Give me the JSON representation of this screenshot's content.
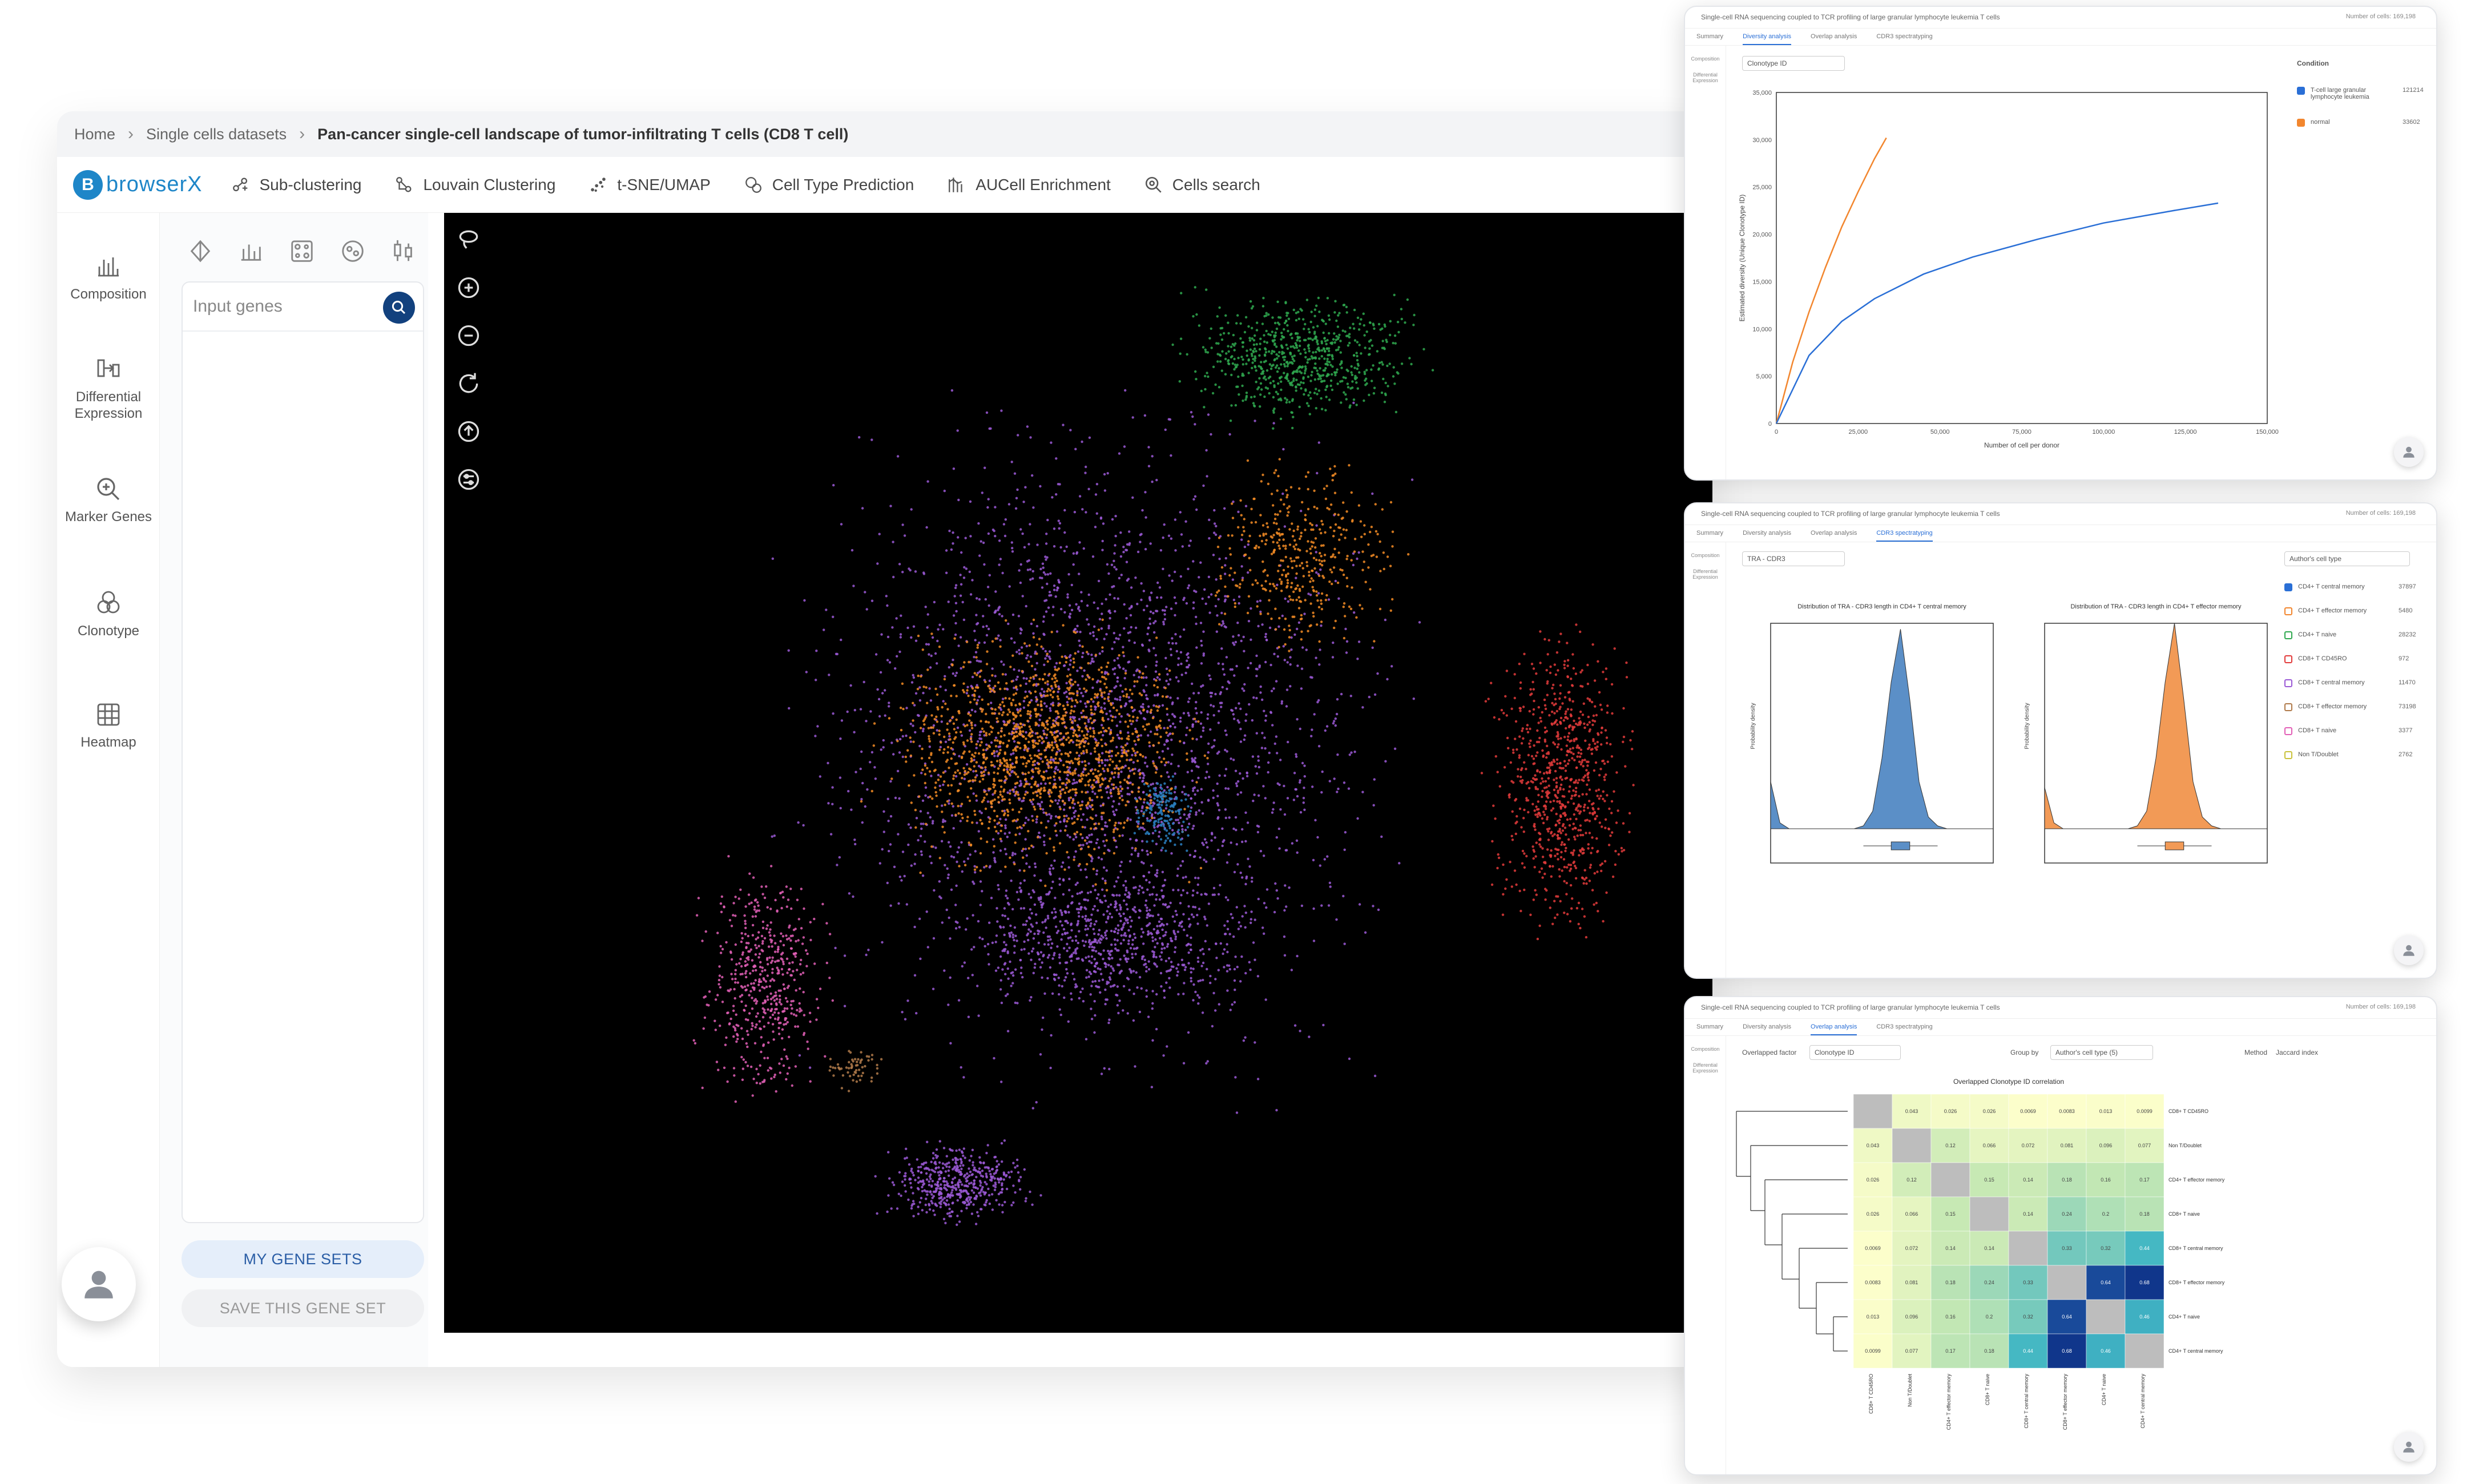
{
  "breadcrumb": {
    "home": "Home",
    "datasets": "Single cells datasets",
    "current": "Pan-cancer single-cell landscape of tumor-infiltrating T cells (CD8 T cell)"
  },
  "logo": {
    "mark": "B",
    "word": "browserX"
  },
  "toolbar": [
    {
      "label": "Sub-clustering",
      "icon": "sub-clustering-icon"
    },
    {
      "label": "Louvain Clustering",
      "icon": "louvain-icon"
    },
    {
      "label": "t-SNE/UMAP",
      "icon": "tsne-icon"
    },
    {
      "label": "Cell Type Prediction",
      "icon": "cell-type-icon"
    },
    {
      "label": "AUCell Enrichment",
      "icon": "aucell-icon"
    },
    {
      "label": "Cells search",
      "icon": "cells-search-icon"
    }
  ],
  "leftnav": [
    {
      "label": "Composition",
      "icon": "composition-icon"
    },
    {
      "label": "Differential Expression",
      "icon": "differential-expression-icon"
    },
    {
      "label": "Marker Genes",
      "icon": "marker-genes-icon"
    },
    {
      "label": "Clonotype",
      "icon": "clonotype-icon"
    },
    {
      "label": "Heatmap",
      "icon": "heatmap-icon"
    }
  ],
  "genes": {
    "placeholder": "Input genes",
    "my_sets": "MY GENE SETS",
    "save_set": "SAVE THIS GENE SET"
  },
  "umap": {
    "background": "#000000",
    "clusters": [
      "#9b59d6",
      "#f28b25",
      "#2fa84f",
      "#e23b3b",
      "#e25fb6",
      "#2a7fc0",
      "#b07a4a"
    ]
  },
  "windows": {
    "diversity": {
      "title": "Single-cell RNA sequencing coupled to TCR profiling of large granular lymphocyte leukemia T cells",
      "meta": "Number of cells: 169,198",
      "tabs": [
        "Summary",
        "Diversity analysis",
        "Overlap analysis",
        "CDR3 spectratyping"
      ],
      "active_tab": 1,
      "side": [
        "Composition",
        "Differential Expression"
      ],
      "dropdown": "Clonotype ID",
      "legend_title": "Condition",
      "legend": [
        {
          "label": "T-cell large granular lymphocyte leukemia",
          "value": "121214",
          "color": "#2a6fd6"
        },
        {
          "label": "normal",
          "value": "33602",
          "color": "#f2862e"
        }
      ]
    },
    "cdr3": {
      "title": "Single-cell RNA sequencing coupled to TCR profiling of large granular lymphocyte leukemia T cells",
      "meta": "Number of cells: 169,198",
      "tabs": [
        "Summary",
        "Diversity analysis",
        "Overlap analysis",
        "CDR3 spectratyping"
      ],
      "active_tab": 3,
      "side": [
        "Composition",
        "Differential Expression"
      ],
      "dropdown": "TRA - CDR3",
      "legend_title": "Author's cell type",
      "legend": [
        {
          "label": "CD4+ T central memory",
          "value": "37897",
          "color": "#2a6fd6"
        },
        {
          "label": "CD4+ T effector memory",
          "value": "5480",
          "color": "#f2862e"
        },
        {
          "label": "CD4+ T naive",
          "value": "28232",
          "color": "#2fa84f"
        },
        {
          "label": "CD8+ T CD45RO",
          "value": "972",
          "color": "#e23b3b"
        },
        {
          "label": "CD8+ T central memory",
          "value": "11470",
          "color": "#9b59d6"
        },
        {
          "label": "CD8+ T effector memory",
          "value": "73198",
          "color": "#b07a4a"
        },
        {
          "label": "CD8+ T naive",
          "value": "3377",
          "color": "#e25fb6"
        },
        {
          "label": "Non T/Doublet",
          "value": "2762",
          "color": "#c9c23b"
        }
      ]
    },
    "overlap": {
      "title": "Single-cell RNA sequencing coupled to TCR profiling of large granular lymphocyte leukemia T cells",
      "meta": "Number of cells: 169,198",
      "tabs": [
        "Summary",
        "Diversity analysis",
        "Overlap analysis",
        "CDR3 spectratyping"
      ],
      "active_tab": 2,
      "side": [
        "Composition",
        "Differential Expression"
      ],
      "controls": {
        "factor_label": "Overlapped factor",
        "factor_value": "Clonotype ID",
        "group_label": "Group by",
        "group_value": "Author's cell type (5)",
        "method_label": "Method",
        "method_value": "Jaccard index"
      }
    }
  },
  "chart_data": [
    {
      "type": "line",
      "ylabel": "Estimated diversity (Unique Clonotype ID)",
      "xlabel": "Number of cell per donor",
      "xlim": [
        0,
        150000
      ],
      "ylim": [
        0,
        35000
      ],
      "x_ticks": [
        "0",
        "25,000",
        "50,000",
        "75,000",
        "100,000",
        "125,000",
        "150,000"
      ],
      "y_ticks": [
        "0",
        "5,000",
        "10,000",
        "15,000",
        "20,000",
        "25,000",
        "30,000",
        "35,000"
      ],
      "series": [
        {
          "color": "#f2862e",
          "x": [
            0,
            5000,
            10000,
            15000,
            20000,
            25000,
            30000,
            33602
          ],
          "y": [
            0,
            6500,
            11800,
            16500,
            20800,
            24500,
            28000,
            30200
          ]
        },
        {
          "color": "#2a6fd6",
          "x": [
            0,
            10000,
            20000,
            30000,
            45000,
            60000,
            80000,
            100000,
            121214,
            135000
          ],
          "y": [
            0,
            7200,
            10800,
            13200,
            15800,
            17600,
            19500,
            21200,
            22500,
            23300
          ]
        }
      ]
    },
    {
      "type": "area",
      "title": "Distribution of TRA - CDR3 length in CD4+ T central memory",
      "xlabel": "",
      "ylabel": "Probability density",
      "color": "#5b8fc7",
      "x": [
        0,
        1,
        2,
        3,
        4,
        5,
        6,
        7,
        8,
        9,
        10,
        11,
        12,
        13,
        14,
        15,
        16,
        17,
        18,
        19,
        20,
        21,
        22,
        23,
        24
      ],
      "y": [
        0.08,
        0.01,
        0.0,
        0.0,
        0.0,
        0.0,
        0.0,
        0.0,
        0.0,
        0.0,
        0.005,
        0.03,
        0.12,
        0.25,
        0.34,
        0.22,
        0.08,
        0.02,
        0.005,
        0.0,
        0.0,
        0.0,
        0.0,
        0.0,
        0.0
      ],
      "ylim": [
        0,
        0.35
      ]
    },
    {
      "type": "area",
      "title": "Distribution of TRA - CDR3 length in CD4+ T effector memory",
      "xlabel": "",
      "ylabel": "Probability density",
      "color": "#f29a56",
      "x": [
        0,
        1,
        2,
        3,
        4,
        5,
        6,
        7,
        8,
        9,
        10,
        11,
        12,
        13,
        14,
        15,
        16,
        17,
        18,
        19,
        20,
        21,
        22,
        23,
        24
      ],
      "y": [
        0.07,
        0.01,
        0.0,
        0.0,
        0.0,
        0.0,
        0.0,
        0.0,
        0.0,
        0.0,
        0.005,
        0.03,
        0.12,
        0.25,
        0.35,
        0.22,
        0.08,
        0.02,
        0.005,
        0.0,
        0.0,
        0.0,
        0.0,
        0.0,
        0.0
      ],
      "ylim": [
        0,
        0.35
      ]
    },
    {
      "type": "heatmap",
      "title": "Overlapped Clonotype ID correlation",
      "rows": [
        "CD8+ T CD45RO",
        "Non T/Doublet",
        "CD4+ T effector memory",
        "CD8+ T naive",
        "CD8+ T central memory",
        "CD8+ T effector memory",
        "CD4+ T naive",
        "CD4+ T central memory"
      ],
      "cols": [
        "CD8+ T CD45RO",
        "Non T/Doublet",
        "CD4+ T effector memory",
        "CD8+ T naive",
        "CD8+ T central memory",
        "CD8+ T effector memory",
        "CD4+ T naive",
        "CD4+ T central memory"
      ],
      "values": [
        [
          null,
          0.043,
          0.026,
          0.026,
          0.0069,
          0.0083,
          0.013,
          0.0099
        ],
        [
          0.043,
          null,
          0.12,
          0.066,
          0.072,
          0.081,
          0.096,
          0.077
        ],
        [
          0.026,
          0.12,
          null,
          0.15,
          0.14,
          0.18,
          0.16,
          0.17
        ],
        [
          0.026,
          0.066,
          0.15,
          null,
          0.14,
          0.24,
          0.2,
          0.18
        ],
        [
          0.0069,
          0.072,
          0.14,
          0.14,
          null,
          0.33,
          0.32,
          0.44
        ],
        [
          0.0083,
          0.081,
          0.18,
          0.24,
          0.33,
          null,
          0.64,
          0.68
        ],
        [
          0.013,
          0.096,
          0.16,
          0.2,
          0.32,
          0.64,
          null,
          0.46
        ],
        [
          0.0099,
          0.077,
          0.17,
          0.18,
          0.44,
          0.68,
          0.46,
          null
        ]
      ]
    }
  ]
}
